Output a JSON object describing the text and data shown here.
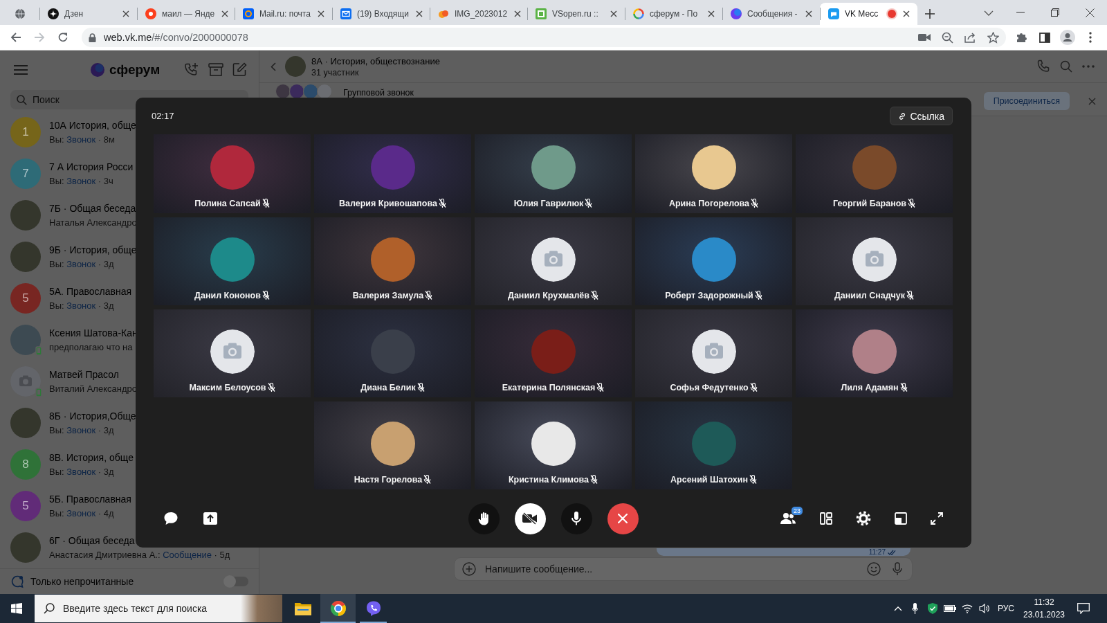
{
  "browser": {
    "tabs": [
      {
        "kind": "dzen",
        "title": "Дзен",
        "selected": false,
        "recording": false
      },
      {
        "kind": "yandex",
        "title": "маил — Янде",
        "selected": false,
        "recording": false
      },
      {
        "kind": "mailru",
        "title": "Mail.ru: почта",
        "selected": false,
        "recording": false
      },
      {
        "kind": "inbox",
        "title": "(19) Входящи",
        "selected": false,
        "recording": false
      },
      {
        "kind": "image",
        "title": "IMG_2023012",
        "selected": false,
        "recording": false
      },
      {
        "kind": "vsopen",
        "title": "VSopen.ru ::",
        "selected": false,
        "recording": false
      },
      {
        "kind": "google",
        "title": "сферум - По",
        "selected": false,
        "recording": false
      },
      {
        "kind": "sferum",
        "title": "Сообщения -",
        "selected": false,
        "recording": false
      },
      {
        "kind": "vk",
        "title": "VK Месс",
        "selected": true,
        "recording": true
      }
    ],
    "address": {
      "host": "web.vk.me",
      "path": "/#/convo/2000000078"
    }
  },
  "sidebar": {
    "logo": "сферум",
    "search_placeholder": "Поиск",
    "chats": [
      {
        "title": "10А История, обще",
        "kind": "letter",
        "letter": "1",
        "color": "#76651a",
        "author": "Вы:",
        "action": "Звонок",
        "time": "· 8м",
        "mobile": false
      },
      {
        "title": "7 А История Росси",
        "kind": "letter",
        "letter": "7",
        "color": "#2e6b77",
        "author": "Вы:",
        "action": "Звонок",
        "time": "· 3ч",
        "mobile": false
      },
      {
        "title": "7Б · Общая беседа",
        "kind": "photo",
        "color": "#34362c",
        "text": "Наталья Александро",
        "mobile": false
      },
      {
        "title": "9Б · История, обще",
        "kind": "photo",
        "color": "#34362c",
        "author": "Вы:",
        "action": "Звонок",
        "time": "· 3д",
        "mobile": false
      },
      {
        "title": "5А. Православная",
        "kind": "letter",
        "letter": "5",
        "color": "#782622",
        "author": "Вы:",
        "action": "Звонок",
        "time": "· 3д",
        "mobile": false
      },
      {
        "title": "Ксения Шатова-Кан",
        "kind": "photo",
        "color": "#3d4a52",
        "text": "предполагаю что на",
        "mobile": true
      },
      {
        "title": "Матвей Прасол",
        "kind": "placeholder",
        "text": "Виталий Александро",
        "mobile": true
      },
      {
        "title": "8Б · История,Обще",
        "kind": "photo",
        "color": "#34362c",
        "author": "Вы:",
        "action": "Звонок",
        "time": "· 3д",
        "mobile": false
      },
      {
        "title": "8В. История, обще",
        "kind": "letter",
        "letter": "8",
        "color": "#2f7238",
        "author": "Вы:",
        "action": "Звонок",
        "time": "· 3д",
        "mobile": false
      },
      {
        "title": "5Б. Православная",
        "kind": "letter",
        "letter": "5",
        "color": "#612b78",
        "author": "Вы:",
        "action": "Звонок",
        "time": "· 4д",
        "mobile": false
      },
      {
        "title": "6Г · Общая беседа",
        "kind": "photo",
        "color": "#34362c",
        "author": "Анастасия Дмитриевна А.:",
        "action": "Сообщение",
        "time": "· 5д",
        "mobile": false
      }
    ],
    "unread_filter": {
      "label": "Только непрочитанные",
      "on": false
    }
  },
  "conversation": {
    "title": "8А · История, обществознание",
    "subtitle": "31 участник",
    "call_banner": {
      "label": "Групповой звонок",
      "join": "Присоединиться"
    },
    "last_message_time": "11:27",
    "composer_placeholder": "Напишите сообщение..."
  },
  "call": {
    "timer": "02:17",
    "link_button": "Ссылка",
    "participants": [
      {
        "name": "Полина Сапсай",
        "kind": "photo",
        "color": "#b0283c",
        "muted": true
      },
      {
        "name": "Валерия Кривошапова",
        "kind": "photo",
        "color": "#5a2a8a",
        "muted": true
      },
      {
        "name": "Юлия Гаврилюк",
        "kind": "photo",
        "color": "#6f9a8a",
        "muted": true
      },
      {
        "name": "Арина Погорелова",
        "kind": "photo",
        "color": "#e8c890",
        "muted": true
      },
      {
        "name": "Георгий Баранов",
        "kind": "photo",
        "color": "#7a4a2a",
        "muted": true
      },
      {
        "name": "Данил Кононов",
        "kind": "photo",
        "color": "#1d8a8a",
        "muted": true
      },
      {
        "name": "Валерия Замула",
        "kind": "photo",
        "color": "#b0602a",
        "muted": true
      },
      {
        "name": "Даниил Крухмалёв",
        "kind": "placeholder",
        "muted": true
      },
      {
        "name": "Роберт Задорожный",
        "kind": "photo",
        "color": "#2a8ac8",
        "muted": true
      },
      {
        "name": "Даниил Снадчук",
        "kind": "placeholder",
        "muted": true
      },
      {
        "name": "Максим Белоусов",
        "kind": "placeholder",
        "muted": true
      },
      {
        "name": "Диана Белик",
        "kind": "photo",
        "color": "#3a3f4a",
        "muted": true
      },
      {
        "name": "Екатерина Полянская",
        "kind": "photo",
        "color": "#7a1e18",
        "muted": true
      },
      {
        "name": "Софья Федутенко",
        "kind": "placeholder",
        "muted": true
      },
      {
        "name": "Лиля Адамян",
        "kind": "photo",
        "color": "#b08088",
        "muted": true
      },
      {
        "name": "Настя Горелова",
        "kind": "photo",
        "color": "#c8a070",
        "muted": true
      },
      {
        "name": "Кристина Климова",
        "kind": "photo",
        "color": "#e8e8e8",
        "muted": true
      },
      {
        "name": "Арсений Шатохин",
        "kind": "photo",
        "color": "#1e5a58",
        "muted": true
      }
    ],
    "controls": [
      {
        "kind": "raise_hand"
      },
      {
        "kind": "camera",
        "on": false
      },
      {
        "kind": "microphone",
        "on": true
      },
      {
        "kind": "hang_up"
      }
    ],
    "participant_count": "23"
  },
  "taskbar": {
    "search_placeholder": "Введите здесь текст для поиска",
    "apps": [
      {
        "kind": "explorer",
        "selected": false,
        "running": false
      },
      {
        "kind": "chrome",
        "selected": true,
        "running": true
      },
      {
        "kind": "viber",
        "selected": false,
        "running": true
      }
    ],
    "language": "РУС",
    "time": "11:32",
    "date": "23.01.2023"
  }
}
